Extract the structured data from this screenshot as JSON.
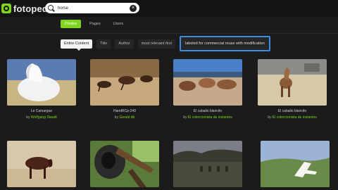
{
  "header": {
    "logo_text": "fotopedia",
    "search": {
      "value": "horse"
    }
  },
  "tabs": [
    {
      "label": "Photos",
      "active": true
    },
    {
      "label": "Pages",
      "active": false
    },
    {
      "label": "Users",
      "active": false
    }
  ],
  "filters": [
    {
      "label": "Entire Content",
      "active": true
    },
    {
      "label": "Title",
      "active": false
    },
    {
      "label": "Author",
      "active": false
    },
    {
      "label": "most relevant first",
      "active": false
    },
    {
      "label": "labeled for commercial reuse with modification",
      "active": false,
      "highlight": true
    }
  ],
  "photos": [
    {
      "caption": "Le Camargue",
      "by": "by",
      "author": "Wolfgang Staudt"
    },
    {
      "caption": "HandRCp-240",
      "by": "by",
      "author": "Gerald db"
    },
    {
      "caption": "El caballo blancito",
      "by": "by",
      "author": "El coleccionista de instantes"
    },
    {
      "caption": "El caballo blancito",
      "by": "by",
      "author": "El coleccionista de instantes"
    },
    {
      "caption": "",
      "by": "",
      "author": ""
    },
    {
      "caption": "",
      "by": "",
      "author": ""
    },
    {
      "caption": "",
      "by": "",
      "author": ""
    },
    {
      "caption": "",
      "by": "",
      "author": ""
    }
  ],
  "colors": {
    "accent": "#7fd321",
    "highlight_border": "#3a8ee6",
    "background": "#1b1b1b"
  }
}
